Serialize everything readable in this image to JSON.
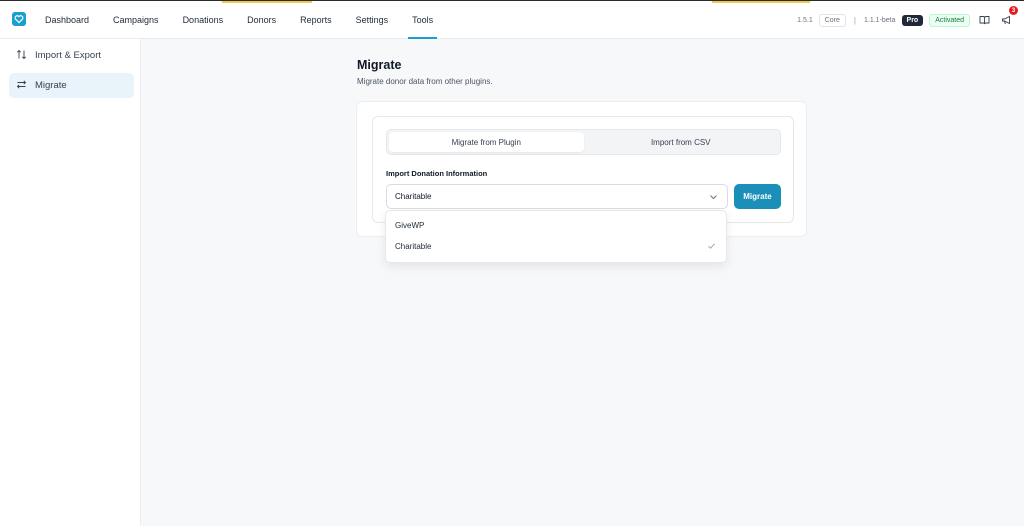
{
  "app": {
    "logo_icon": "heart-logo-icon",
    "brand_color": "#1a9ecf"
  },
  "nav": {
    "items": [
      {
        "label": "Dashboard",
        "active": false
      },
      {
        "label": "Campaigns",
        "active": false
      },
      {
        "label": "Donations",
        "active": false
      },
      {
        "label": "Donors",
        "active": false
      },
      {
        "label": "Reports",
        "active": false
      },
      {
        "label": "Settings",
        "active": false
      },
      {
        "label": "Tools",
        "active": true
      }
    ]
  },
  "header_right": {
    "core_version": "1.5.1",
    "core_label": "Core",
    "separator": "|",
    "pro_version": "1.1.1-beta",
    "pro_label": "Pro",
    "status_label": "Activated",
    "docs_icon": "book-icon",
    "notifications_icon": "megaphone-icon",
    "notification_count": "3"
  },
  "sidebar": {
    "items": [
      {
        "label": "Import & Export",
        "icon": "arrows-up-down-icon",
        "active": false
      },
      {
        "label": "Migrate",
        "icon": "arrows-left-right-icon",
        "active": true
      }
    ]
  },
  "main": {
    "title": "Migrate",
    "subtitle": "Migrate donor data from other plugins.",
    "tabs": [
      {
        "label": "Migrate from Plugin",
        "active": true
      },
      {
        "label": "Import from CSV",
        "active": false
      }
    ],
    "field_label": "Import Donation Information",
    "select_value": "Charitable",
    "migrate_button": "Migrate",
    "accent_color": "#1a8fb8"
  },
  "dropdown": {
    "options": [
      {
        "label": "GiveWP",
        "selected": false
      },
      {
        "label": "Charitable",
        "selected": true
      }
    ]
  }
}
